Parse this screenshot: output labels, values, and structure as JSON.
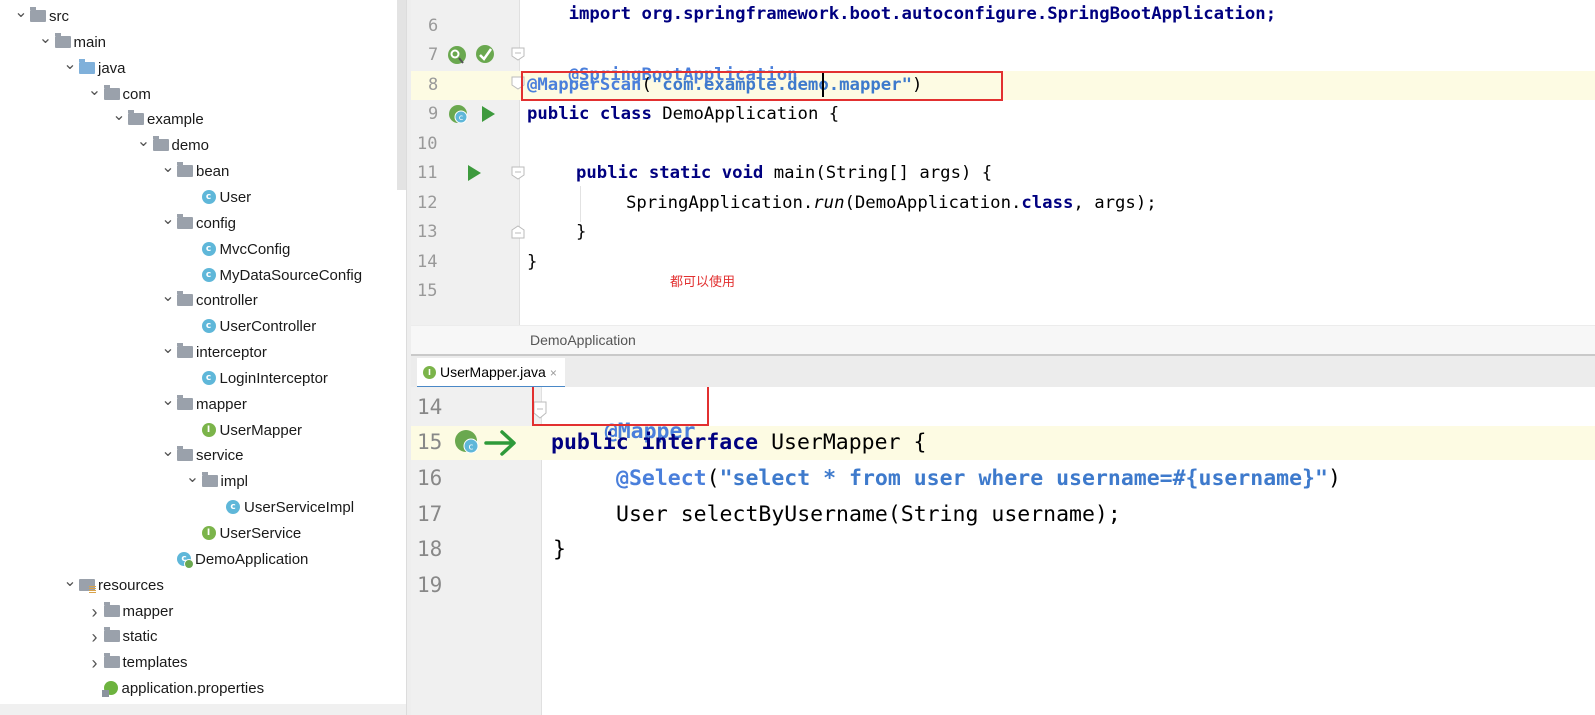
{
  "tree": {
    "items": [
      {
        "label": "src",
        "arrow": "v",
        "icon": "folder-gray",
        "indent": 0
      },
      {
        "label": "main",
        "arrow": "v",
        "icon": "folder-gray",
        "indent": 1
      },
      {
        "label": "java",
        "arrow": "v",
        "icon": "folder-blue",
        "indent": 2
      },
      {
        "label": "com",
        "arrow": "v",
        "icon": "folder-gray",
        "indent": 3
      },
      {
        "label": "example",
        "arrow": "v",
        "icon": "folder-gray",
        "indent": 4
      },
      {
        "label": "demo",
        "arrow": "v",
        "icon": "folder-gray",
        "indent": 5
      },
      {
        "label": "bean",
        "arrow": "v",
        "icon": "folder-gray",
        "indent": 6
      },
      {
        "label": "User",
        "arrow": "",
        "icon": "class-c",
        "indent": 7
      },
      {
        "label": "config",
        "arrow": "v",
        "icon": "folder-gray",
        "indent": 6
      },
      {
        "label": "MvcConfig",
        "arrow": "",
        "icon": "class-c",
        "indent": 7
      },
      {
        "label": "MyDataSourceConfig",
        "arrow": "",
        "icon": "class-c",
        "indent": 7
      },
      {
        "label": "controller",
        "arrow": "v",
        "icon": "folder-gray",
        "indent": 6
      },
      {
        "label": "UserController",
        "arrow": "",
        "icon": "class-c",
        "indent": 7
      },
      {
        "label": "interceptor",
        "arrow": "v",
        "icon": "folder-gray",
        "indent": 6
      },
      {
        "label": "LoginInterceptor",
        "arrow": "",
        "icon": "class-c",
        "indent": 7
      },
      {
        "label": "mapper",
        "arrow": "v",
        "icon": "folder-gray",
        "indent": 6
      },
      {
        "label": "UserMapper",
        "arrow": "",
        "icon": "interface-i",
        "indent": 7
      },
      {
        "label": "service",
        "arrow": "v",
        "icon": "folder-gray",
        "indent": 6
      },
      {
        "label": "impl",
        "arrow": "v",
        "icon": "folder-gray",
        "indent": 7
      },
      {
        "label": "UserServiceImpl",
        "arrow": "",
        "icon": "class-c",
        "indent": 8
      },
      {
        "label": "UserService",
        "arrow": "",
        "icon": "interface-i",
        "indent": 7
      },
      {
        "label": "DemoApplication",
        "arrow": "",
        "icon": "spring-boot-class",
        "indent": 6
      },
      {
        "label": "resources",
        "arrow": "v",
        "icon": "folder-resources",
        "indent": 2
      },
      {
        "label": "mapper",
        "arrow": ">",
        "icon": "folder-gray",
        "indent": 3
      },
      {
        "label": "static",
        "arrow": ">",
        "icon": "folder-gray",
        "indent": 3
      },
      {
        "label": "templates",
        "arrow": ">",
        "icon": "folder-gray",
        "indent": 3
      },
      {
        "label": "application.properties",
        "arrow": "",
        "icon": "spring-properties",
        "indent": 3
      }
    ]
  },
  "editor_top": {
    "line_numbers": [
      "6",
      "7",
      "8",
      "9",
      "10",
      "11",
      "12",
      "13",
      "14",
      "15"
    ],
    "partial_top_line": "import org.springframework.boot.autoconfigure.SpringBootApplication;",
    "line7": {
      "annotation": "@SpringBootApplication"
    },
    "line8": {
      "annotation": "@MapperScan",
      "paren_open": "(",
      "string_a": "\"com.example",
      "string_b": ".demo.mapper\"",
      "paren_close": ")"
    },
    "line9": {
      "kw1": "public",
      "kw2": "class",
      "name": " DemoApplication {"
    },
    "line11": {
      "kw1": "public",
      "kw2": "static",
      "kw3": "void",
      "rest": " main(String[] args) {"
    },
    "line12": {
      "pre": "SpringApplication.",
      "italic": "run",
      "mid": "(DemoApplication.",
      "kw": "class",
      "post": ", args);"
    },
    "line13": "}",
    "line14": "}",
    "note": "都可以使用",
    "breadcrumb": "DemoApplication"
  },
  "tab": {
    "label": "UserMapper.java",
    "close": "×",
    "icon": "interface-i"
  },
  "editor_bottom": {
    "line_numbers": [
      "14",
      "15",
      "16",
      "17",
      "18",
      "19"
    ],
    "line14": {
      "annotation": "@Mapper"
    },
    "line15": {
      "kw1": "public",
      "kw2": "interface",
      "rest": " UserMapper {"
    },
    "line16": {
      "annotation": "@Select",
      "paren_open": "(",
      "string": "\"select * from user where username=#{username}\"",
      "paren_close": ")"
    },
    "line17": "User selectByUsername(String username);",
    "line18": "}"
  },
  "colors": {
    "highlight_box": "#e23030",
    "keyword": "#000080",
    "annotation": "#4a7fdb",
    "current_line": "#fdfbe3"
  }
}
